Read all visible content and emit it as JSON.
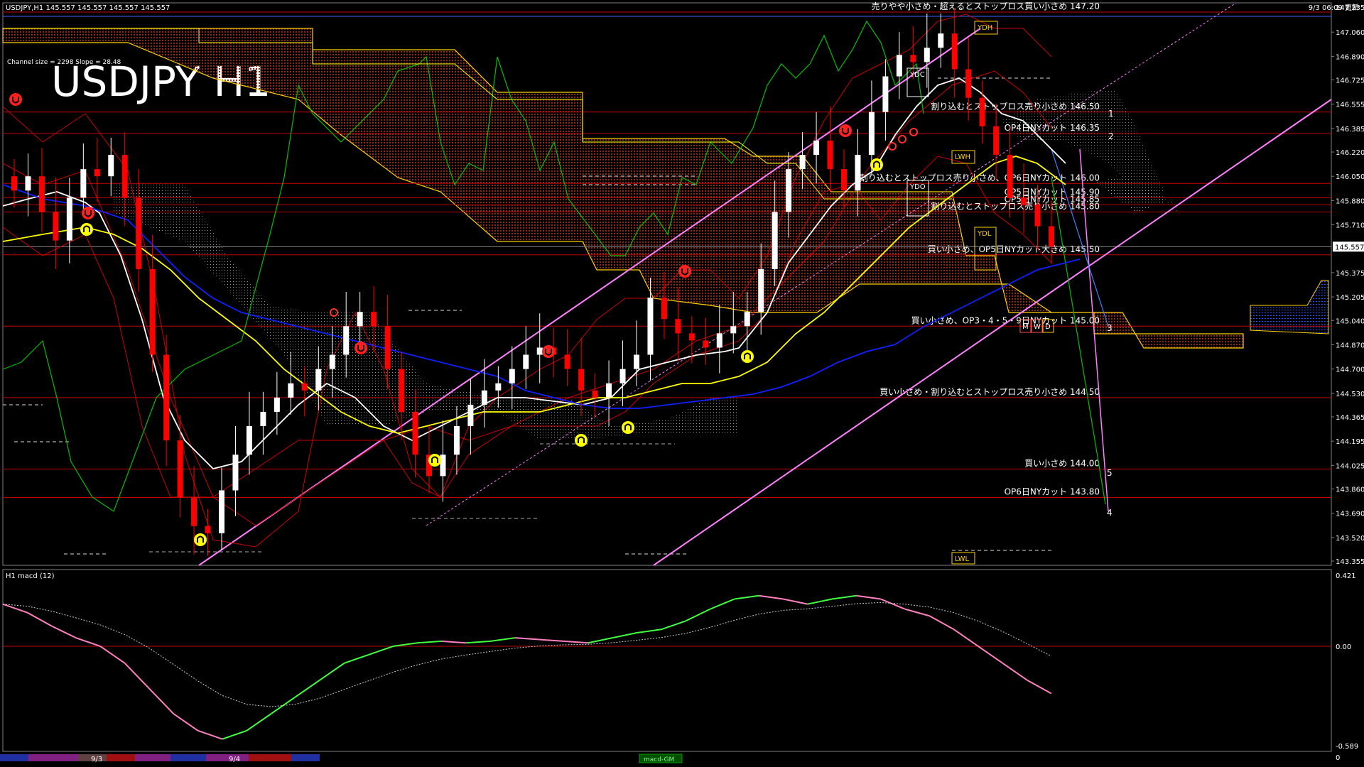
{
  "header": {
    "symbol_line": "USDJPY,H1  145.557 145.557 145.557 145.557",
    "datetime": "9/3 06:09 更新",
    "channel_info": "Channel size = 2298 Slope = 28.48",
    "big_title": "USDJPY H1"
  },
  "colors": {
    "background": "#000000",
    "frame": "#808080",
    "level_line": "#c00000",
    "cloud": "#8b2a1a",
    "channel": "#ff80ff",
    "sma_fast": "#ffffff",
    "sma_mid": "#ffff00",
    "sma_slow": "#1020ff",
    "chikou": "#00c000",
    "bollinger": "#cc0000",
    "macd_up": "#40ff40",
    "macd_down": "#ff80c0",
    "candle_up": "#ffffff",
    "candle_down": "#ff0000",
    "arrow_marker": "#ffff00",
    "stop_marker": "#ff2020"
  },
  "price_axis": {
    "ticks": [
      "147.235",
      "147.060",
      "146.890",
      "146.725",
      "146.555",
      "146.385",
      "146.220",
      "146.050",
      "145.880",
      "145.710",
      "145.375",
      "145.205",
      "145.040",
      "144.870",
      "144.700",
      "144.530",
      "144.365",
      "144.195",
      "144.025",
      "143.860",
      "143.690",
      "143.520",
      "143.355"
    ],
    "current_price": "145.557"
  },
  "levels": [
    {
      "price": 147.2,
      "text": "売りやや小さめ・超えるとストップロス買い小さめ 147.20"
    },
    {
      "price": 146.5,
      "text": "割り込むとストップロス売り小さめ 146.50"
    },
    {
      "price": 146.35,
      "text": "OP4日NYカット 146.35"
    },
    {
      "price": 146.0,
      "text": "割り込むとストップロス売り小さめ、OP6日NYカット 146.00"
    },
    {
      "price": 145.9,
      "text": "OP5日NYカット 145.90"
    },
    {
      "price": 145.85,
      "text": "OP5日NYカット 145.85"
    },
    {
      "price": 145.8,
      "text": "割り込むとストップロス売り小さめ 145.80"
    },
    {
      "price": 145.5,
      "text": "買い小さめ、OP5日NYカット大きめ 145.50"
    },
    {
      "price": 145.0,
      "text": "買い小さめ、OP3・4・5・9日NYカット 145.00"
    },
    {
      "price": 144.5,
      "text": "買い小さめ・割り込むとストップロス売り小さめ 144.50"
    },
    {
      "price": 144.0,
      "text": "買い小さめ 144.00"
    },
    {
      "price": 143.8,
      "text": "OP6日NYカット 143.80"
    }
  ],
  "markers": {
    "boxes": [
      "YDH",
      "YDC",
      "YDO",
      "YDL",
      "LWH",
      "LWL"
    ],
    "mwd": [
      "M",
      "W",
      "D"
    ],
    "wave_numbers": [
      "1",
      "2",
      "3",
      "4",
      "5"
    ]
  },
  "macd": {
    "label": "H1  macd (12)",
    "ticks": [
      "0.421",
      "0.00",
      "-0.589"
    ],
    "bottom_value": "0"
  },
  "time_axis": {
    "labels": [
      "9/3",
      "9/4"
    ],
    "tab": "macd-GM"
  },
  "chart_data": {
    "type": "candlestick",
    "title": "USDJPY H1",
    "ylim": [
      143.355,
      147.235
    ],
    "categories": [
      "9/3",
      "9/4"
    ],
    "close_series": [
      145.95,
      146.05,
      145.8,
      145.6,
      145.9,
      146.1,
      146.05,
      146.2,
      145.9,
      145.4,
      144.8,
      144.2,
      143.8,
      143.6,
      143.55,
      143.85,
      144.1,
      144.3,
      144.4,
      144.5,
      144.6,
      144.55,
      144.7,
      144.8,
      145.0,
      145.1,
      145.0,
      144.7,
      144.4,
      144.1,
      143.95,
      144.1,
      144.3,
      144.45,
      144.55,
      144.6,
      144.7,
      144.8,
      144.85,
      144.8,
      144.7,
      144.55,
      144.5,
      144.6,
      144.7,
      144.8,
      145.2,
      145.05,
      144.95,
      144.9,
      144.85,
      144.95,
      145.0,
      145.1,
      145.4,
      145.8,
      146.1,
      146.2,
      146.3,
      146.1,
      145.95,
      146.2,
      146.5,
      146.75,
      146.9,
      146.85,
      146.95,
      147.05,
      146.8,
      146.6,
      146.4,
      146.2,
      145.9,
      145.85,
      145.7,
      145.557
    ],
    "series": [
      {
        "name": "macd",
        "values": [
          0.25,
          0.2,
          0.12,
          0.05,
          0.0,
          -0.1,
          -0.25,
          -0.4,
          -0.5,
          -0.55,
          -0.5,
          -0.4,
          -0.3,
          -0.2,
          -0.1,
          -0.05,
          0.0,
          0.02,
          0.03,
          0.02,
          0.03,
          0.05,
          0.04,
          0.03,
          0.02,
          0.05,
          0.08,
          0.1,
          0.15,
          0.22,
          0.28,
          0.3,
          0.28,
          0.25,
          0.28,
          0.3,
          0.28,
          0.22,
          0.18,
          0.1,
          0.0,
          -0.1,
          -0.2,
          -0.28
        ]
      }
    ]
  }
}
